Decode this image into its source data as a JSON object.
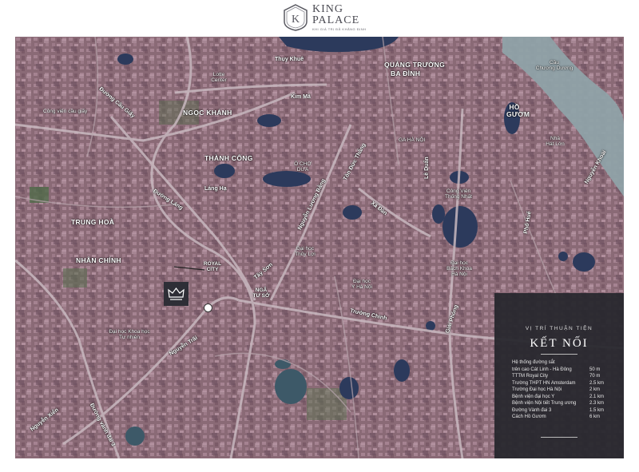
{
  "brand": {
    "name_line1": "KING",
    "name_line2": "PALACE",
    "tagline": "KHI GIÁ TRỊ ĐÃ KHẲNG ĐỊNH",
    "crest_letter": "K"
  },
  "map": {
    "labels": {
      "thuy_khue": "Thụy Khuê",
      "quang_truong": "QUẢNG TRƯỜNG",
      "ba_dinh": "BA ĐÌNH",
      "cau_chuong_duong_1": "Cầu",
      "cau_chuong_duong_2": "Chương Dương",
      "duong_cau_giay": "Đường Cầu Giấy",
      "lotte_1": "Lotte",
      "lotte_2": "Center",
      "kim_ma": "Kim Mã",
      "cong_vien_cau_giay": "Công viên cầu giấy",
      "ngoc_khanh": "NGỌC KHÁNH",
      "ho": "HỒ",
      "guom": "GƯƠM",
      "ga_ha_noi": "GA HÀ NỘI",
      "nha_hat_lon_1": "Nhà",
      "nha_hat_lon_2": "Hát Lớn",
      "ton_duc_thang": "Tôn Đức Thắng",
      "nguyen_khoai": "Nguyễn Khoái",
      "thanh_cong": "THÀNH CÔNG",
      "o_cho_dua_1": "Ô CHỢ",
      "o_cho_dua_2": "DỪA",
      "le_duan": "Lê Duẩn",
      "lang_ha": "Láng Hạ",
      "cong_vien_thong_nhat_1": "Công Viên",
      "cong_vien_thong_nhat_2": "Thống Nhất",
      "duong_lang": "Đường Láng",
      "nguyen_luong_bang": "Nguyễn Lương Bằng",
      "xa_dan": "Xã Đàn",
      "trung_hoa": "TRUNG HOÀ",
      "pho_hue": "Phố Huế",
      "nhan_chinh": "NHÂN CHÍNH",
      "dai_hoc_thuy_loi_1": "Đại học",
      "dai_hoc_thuy_loi_2": "Thủy Lợi",
      "dai_hoc_bach_khoa_1": "Đại học",
      "dai_hoc_bach_khoa_2": "Bách Khoa",
      "dai_hoc_bach_khoa_3": "Hà Nội",
      "royal_city_1": "ROYAL",
      "royal_city_2": "CITY",
      "tay_son": "Tây Sơn",
      "dai_hoc_y_1": "Đại học",
      "dai_hoc_y_2": "Y Hà Nội",
      "nga_tu_so_1": "NGÃ",
      "nga_tu_so_2": "TƯ SỞ",
      "giai_phong": "Giải Phóng",
      "truong_chinh": "Trường Chinh",
      "dai_hoc_khoa_hoc_1": "Đại học Khoa học",
      "dai_hoc_khoa_hoc_2": "Tự nhiên",
      "nguyen_trai": "Nguyễn Trãi",
      "nguyen_xien": "Nguyễn Xiển",
      "duong_vanh_dai_3": "Đường vành đai 3"
    }
  },
  "panel": {
    "subtitle": "VỊ TRÍ THUẬN TIỆN",
    "title": "KẾT NỐI",
    "rows": [
      {
        "label": "Hệ thống đường sắt",
        "value": ""
      },
      {
        "label": "trên cao Cát Linh - Hà Đông",
        "value": "50 m"
      },
      {
        "label": "TTTM Royal City",
        "value": "70 m"
      },
      {
        "label": "Trường THPT HN Amsterdam",
        "value": "2.5 km"
      },
      {
        "label": "Trường Đại học Hà Nội",
        "value": "2 km"
      },
      {
        "label": "Bệnh viện đại học Y",
        "value": "2.1 km"
      },
      {
        "label": "Bệnh viện Nội tiết Trung ương",
        "value": "2.3 km"
      },
      {
        "label": "Đường Vành đai 3",
        "value": "1.5 km"
      },
      {
        "label": "Cách Hồ Gươm",
        "value": "6 km"
      }
    ]
  }
}
